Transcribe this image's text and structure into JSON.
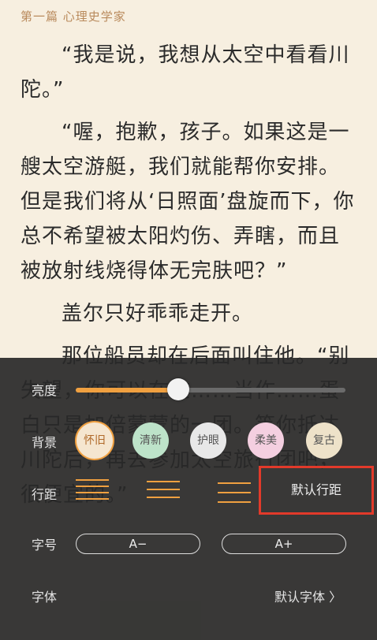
{
  "chapter": {
    "title": "第一篇 心理史学家"
  },
  "content": {
    "paragraphs": [
      "“我是说，我想从太空中看看川陀。”",
      "“喔，抱歉，孩子。如果这是一艘太空游艇，我们就能帮你安排。但是我们将从‘日照面’盘旋而下，你总不希望被太阳灼伤、弄瞎，而且被放射线烧得体无完肤吧？”",
      "盖尔只好乖乖走开。",
      "那位船员却在后面叫住他。“别失望，你可以在这……当作……蛋白只是加倍蒙蒙的一团。等你抵达川陀后，再去参加太空旅行团吧，很便宜的。”"
    ]
  },
  "panel": {
    "brightness": {
      "label": "亮度",
      "level_percent": 38
    },
    "background": {
      "label": "背景",
      "options": [
        {
          "label": "怀旧",
          "color": "#f5e6d0",
          "active": true
        },
        {
          "label": "清新",
          "color": "#bde3c9",
          "active": false
        },
        {
          "label": "护眼",
          "color": "#e8e8e8",
          "active": false
        },
        {
          "label": "柔美",
          "color": "#f4cfe0",
          "active": false
        },
        {
          "label": "复古",
          "color": "#eee2c9",
          "active": false
        }
      ]
    },
    "spacing": {
      "label": "行距",
      "default_label": "默认行距"
    },
    "font_size": {
      "label": "字号",
      "decrease": "A−",
      "increase": "A+"
    },
    "font": {
      "label": "字体",
      "value": "默认字体 〉"
    }
  },
  "colors": {
    "accent": "#f0a040",
    "highlight_box": "#e23a2a"
  }
}
